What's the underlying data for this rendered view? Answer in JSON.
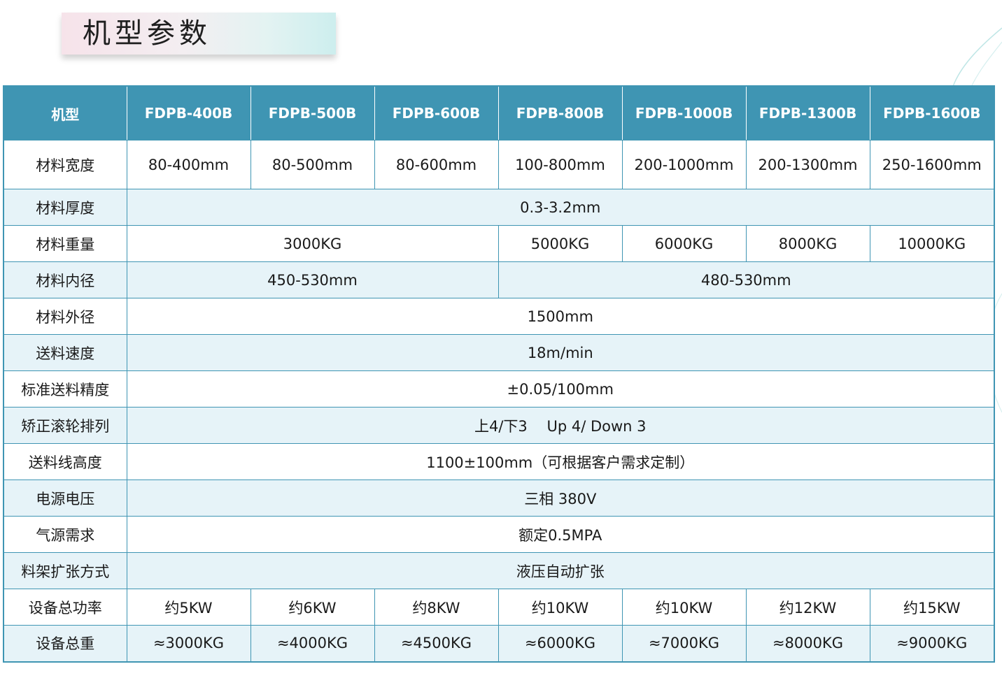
{
  "title": "机型参数",
  "table": {
    "header": [
      "机型",
      "FDPB-400B",
      "FDPB-500B",
      "FDPB-600B",
      "FDPB-800B",
      "FDPB-1000B",
      "FDPB-1300B",
      "FDPB-1600B"
    ],
    "rows": [
      {
        "label": "材料宽度",
        "cells": [
          "80-400mm",
          "80-500mm",
          "80-600mm",
          "100-800mm",
          "200-1000mm",
          "200-1300mm",
          "250-1600mm"
        ]
      },
      {
        "label": "材料厚度",
        "cells": [
          "0.3-3.2mm"
        ]
      },
      {
        "label": "材料重量",
        "cells": [
          "3000KG",
          "5000KG",
          "6000KG",
          "8000KG",
          "10000KG"
        ]
      },
      {
        "label": "材料内径",
        "cells": [
          "450-530mm",
          "480-530mm"
        ]
      },
      {
        "label": "材料外径",
        "cells": [
          "1500mm"
        ]
      },
      {
        "label": "送料速度",
        "cells": [
          "18m/min"
        ]
      },
      {
        "label": "标准送料精度",
        "cells": [
          "±0.05/100mm"
        ]
      },
      {
        "label": "矫正滚轮排列",
        "cells": [
          "上4/下3　 Up 4/ Down 3"
        ]
      },
      {
        "label": "送料线高度",
        "cells": [
          "1100±100mm（可根据客户需求定制）"
        ]
      },
      {
        "label": "电源电压",
        "cells": [
          "三相 380V"
        ]
      },
      {
        "label": "气源需求",
        "cells": [
          "额定0.5MPA"
        ]
      },
      {
        "label": "料架扩张方式",
        "cells": [
          "液压自动扩张"
        ]
      },
      {
        "label": "设备总功率",
        "cells": [
          "约5KW",
          "约6KW",
          "约8KW",
          "约10KW",
          "约10KW",
          "约12KW",
          "约15KW"
        ]
      },
      {
        "label": "设备总重",
        "cells": [
          "≈3000KG",
          "≈4000KG",
          "≈4500KG",
          "≈6000KG",
          "≈7000KG",
          "≈8000KG",
          "≈9000KG"
        ]
      }
    ]
  }
}
